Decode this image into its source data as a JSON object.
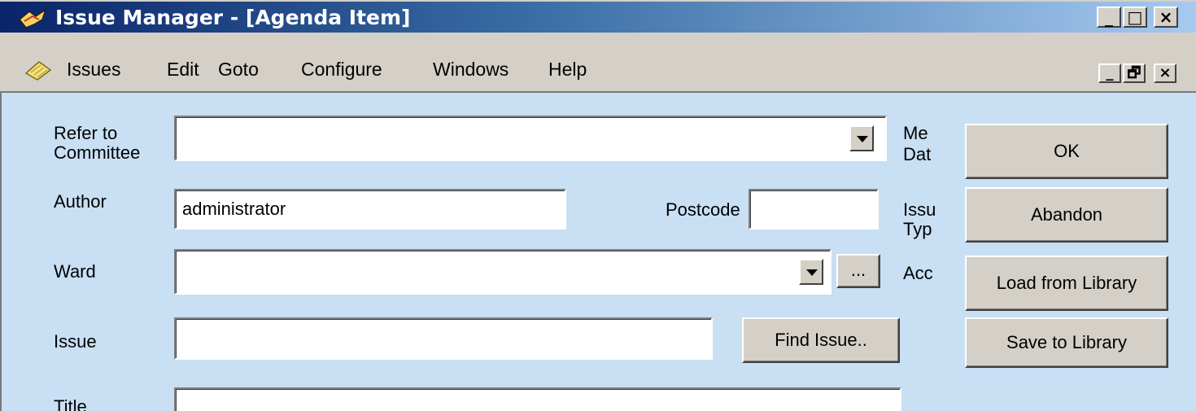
{
  "window": {
    "title": "Issue Manager - [Agenda Item]",
    "controls": {
      "minimize": "_",
      "maximize": "□",
      "close": "×"
    }
  },
  "menu": {
    "items": [
      "Issues",
      "Edit",
      "Goto",
      "Configure",
      "Windows",
      "Help"
    ],
    "mdi_controls": {
      "minimize": "_",
      "restore": "🗗",
      "close": "×"
    }
  },
  "form": {
    "refer_to_committee": {
      "label_line1": "Refer to",
      "label_line2": "Committee",
      "value": ""
    },
    "author": {
      "label": "Author",
      "value": "administrator"
    },
    "postcode": {
      "label": "Postcode",
      "value": ""
    },
    "ward": {
      "label": "Ward",
      "value": "",
      "ellipsis": "..."
    },
    "issue": {
      "label": "Issue",
      "value": "",
      "find_button": "Find Issue.."
    },
    "title": {
      "label": "Title",
      "value": ""
    },
    "truncated_labels": {
      "meeting_date_1": "Me",
      "meeting_date_2": "Dat",
      "issue_type_1": "Issu",
      "issue_type_2": "Typ",
      "acc": "Acc"
    }
  },
  "buttons": {
    "ok": "OK",
    "abandon": "Abandon",
    "load_from_library": "Load from Library",
    "save_to_library": "Save to Library"
  },
  "colors": {
    "titlebar_start": "#0a246a",
    "titlebar_end": "#a6caf0",
    "client_bg": "#c8dff4",
    "chrome": "#d4d0c8"
  },
  "icons": {
    "app": "issue-manager-icon",
    "menu": "notepad-icon"
  }
}
